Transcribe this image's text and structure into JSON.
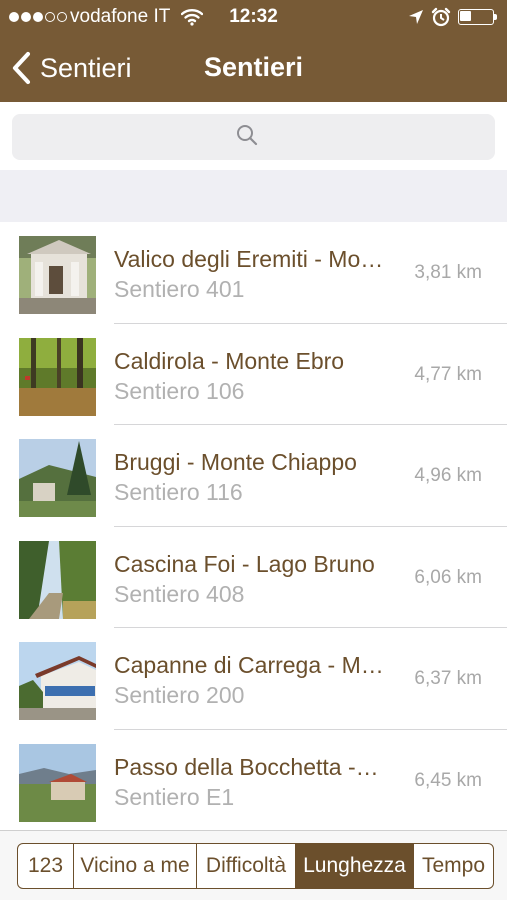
{
  "status_bar": {
    "carrier": "vodafone IT",
    "time": "12:32",
    "battery_level": 0.35
  },
  "nav": {
    "back_label": "Sentieri",
    "title": "Sentieri"
  },
  "search": {
    "placeholder": ""
  },
  "list": {
    "items": [
      {
        "title": "Valico degli Eremiti - Mo…",
        "subtitle": "Sentiero 401",
        "distance": "3,81 km"
      },
      {
        "title": "Caldirola - Monte Ebro",
        "subtitle": "Sentiero 106",
        "distance": "4,77 km"
      },
      {
        "title": "Bruggi - Monte Chiappo",
        "subtitle": "Sentiero 116",
        "distance": "4,96 km"
      },
      {
        "title": "Cascina Foi - Lago Bruno",
        "subtitle": "Sentiero 408",
        "distance": "6,06 km"
      },
      {
        "title": "Capanne di Carrega - M…",
        "subtitle": "Sentiero 200",
        "distance": "6,37 km"
      },
      {
        "title": "Passo della Bocchetta -…",
        "subtitle": "Sentiero E1",
        "distance": "6,45 km"
      }
    ]
  },
  "sort_control": {
    "options": [
      "123",
      "Vicino a me",
      "Difficoltà",
      "Lunghezza",
      "Tempo"
    ],
    "selected": "Lunghezza"
  },
  "colors": {
    "brand_brown": "#775a36",
    "text_brown": "#6b4f2c",
    "secondary_gray": "#b1b1b1"
  },
  "icons": {
    "back": "chevron-left-icon",
    "search": "magnifier-icon",
    "wifi": "wifi-icon",
    "location": "location-arrow-icon",
    "alarm": "alarm-clock-icon",
    "battery": "battery-icon"
  }
}
